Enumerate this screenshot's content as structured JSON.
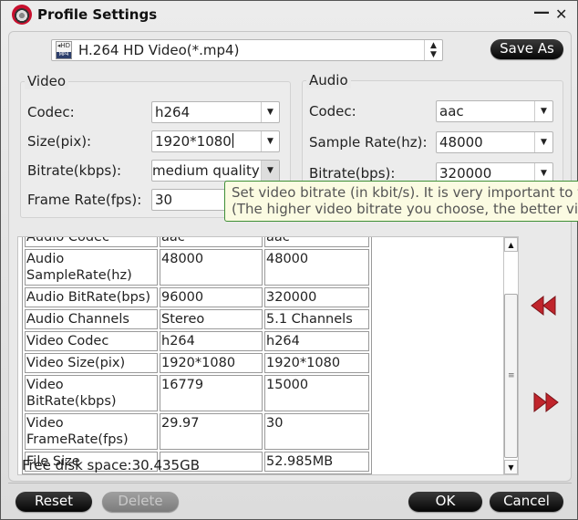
{
  "window": {
    "title": "Profile Settings",
    "minimize_glyph": "—",
    "close_glyph": "✕"
  },
  "format": {
    "icon": "hd-mp4-icon",
    "icon_text": "◂HD",
    "selected": "H.264 HD Video(*.mp4)",
    "spin_glyph": "▲\n▼"
  },
  "save_as_label": "Save As",
  "video": {
    "title": "Video",
    "codec_label": "Codec:",
    "codec_value": "h264",
    "size_label": "Size(pix):",
    "size_value": "1920*1080",
    "bitrate_label": "Bitrate(kbps):",
    "bitrate_value": "medium quality",
    "framerate_label": "Frame Rate(fps):",
    "framerate_value": "30"
  },
  "audio": {
    "title": "Audio",
    "codec_label": "Codec:",
    "codec_value": "aac",
    "samplerate_label": "Sample Rate(hz):",
    "samplerate_value": "48000",
    "bitrate_label": "Bitrate(bps):",
    "bitrate_value": "320000"
  },
  "tooltip": {
    "line1": "Set video bitrate (in kbit/s). It is very important to t",
    "line2": "(The higher video bitrate you choose, the better vid"
  },
  "info_table": {
    "rows": [
      [
        "Audio Codec",
        "aac",
        "aac"
      ],
      [
        "Audio SampleRate(hz)",
        "48000",
        "48000"
      ],
      [
        "Audio BitRate(bps)",
        "96000",
        "320000"
      ],
      [
        "Audio Channels",
        "Stereo",
        "5.1 Channels"
      ],
      [
        "Video Codec",
        "h264",
        "h264"
      ],
      [
        "Video Size(pix)",
        "1920*1080",
        "1920*1080"
      ],
      [
        "Video BitRate(kbps)",
        "16779",
        "15000"
      ],
      [
        "Video FrameRate(fps)",
        "29.97",
        "30"
      ],
      [
        "File Size",
        "",
        "52.985MB"
      ]
    ],
    "free_disk_space": "Free disk space:30.435GB"
  },
  "scrollbar": {
    "up": "▲",
    "down": "▼",
    "grip": "≡"
  },
  "buttons": {
    "reset": "Reset",
    "delete": "Delete",
    "ok": "OK",
    "cancel": "Cancel"
  },
  "colors": {
    "accent_red": "#c0242b",
    "tooltip_bg": "#fbfbe2",
    "tooltip_border": "#3f8f36",
    "button_dark": "#111111"
  }
}
